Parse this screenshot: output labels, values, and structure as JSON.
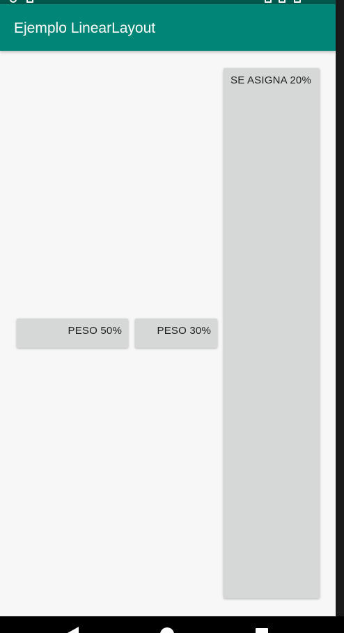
{
  "app": {
    "title": "Ejemplo LinearLayout"
  },
  "buttons": {
    "peso_50": "PESO 50%",
    "peso_30": "PESO 30%",
    "se_asigna_20": "SE ASIGNA 20%"
  },
  "icons": {
    "status_left": [
      "notification-icon",
      "sd-card-icon"
    ],
    "status_right": [
      "wifi-icon",
      "signal-icon",
      "battery-icon"
    ],
    "nav": [
      "back-icon",
      "home-icon",
      "recents-icon"
    ]
  },
  "colors": {
    "primary": "#008577",
    "primary_dark": "#00574b",
    "button_bg": "#d6d7d7",
    "background": "#f7f7f7"
  }
}
